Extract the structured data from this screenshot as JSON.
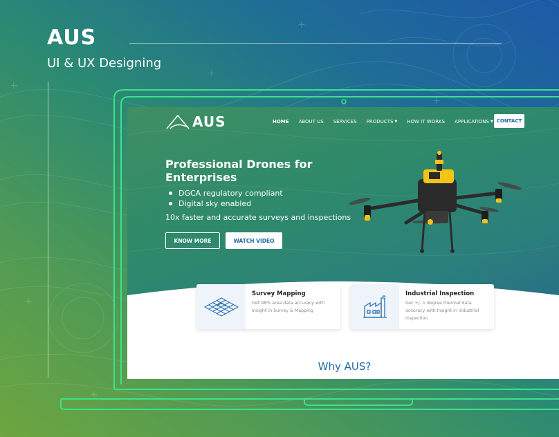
{
  "header": {
    "title": "AUS",
    "subtitle": "UI & UX Designing"
  },
  "site": {
    "logo_text": "AUS",
    "nav": [
      {
        "label": "HOME"
      },
      {
        "label": "ABOUT US"
      },
      {
        "label": "SERVICES"
      },
      {
        "label": "PRODUCTS"
      },
      {
        "label": "HOW IT WORKS"
      },
      {
        "label": "APPLICATIONS"
      }
    ],
    "contact_label": "CONTACT",
    "hero": {
      "title": "Professional Drones for Enterprises",
      "bullets": [
        "DGCA regulatory compliant",
        "Digital sky enabled"
      ],
      "tagline": "10x faster and accurate surveys and inspections",
      "know_more": "KNOW MORE",
      "watch_video": "WATCH VIDEO"
    },
    "cards": [
      {
        "title": "Survey Mapping",
        "description": "Get 98% area data accuracy with Insight in Survey & Mapping",
        "icon": "survey-grid-icon"
      },
      {
        "title": "Industrial Inspection",
        "description": "Get +/- 1 degree thermal data accuracy with Insight in Industrial Inspection",
        "icon": "factory-icon"
      }
    ],
    "why_heading": "Why AUS?"
  },
  "colors": {
    "accent_blue": "#1f6aa8",
    "laptop_outline": "#3ee08a",
    "drone_yellow": "#f2c418"
  }
}
